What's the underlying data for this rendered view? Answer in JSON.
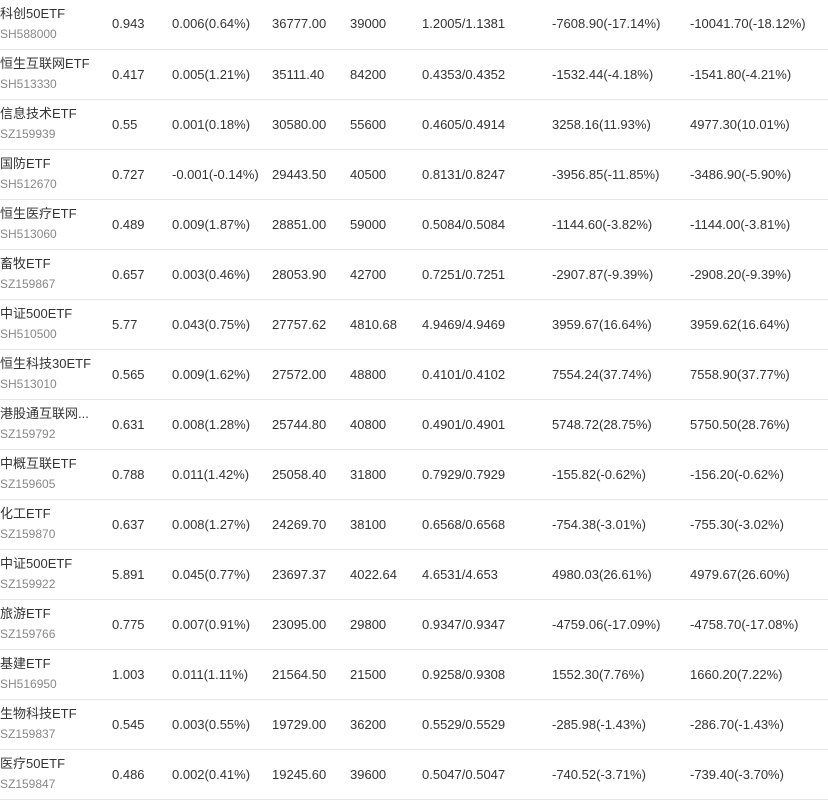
{
  "colors": {
    "up": "#e5302a",
    "down": "#2a9d3e",
    "text": "#333333",
    "code": "#888888",
    "divider": "#e5e5e5"
  },
  "rows": [
    {
      "name": "科创50ETF",
      "code": "SH588000",
      "price": "0.943",
      "change": "0.006(0.64%)",
      "change_dir": "up",
      "amount": "36777.00",
      "shares": "39000",
      "nav": "1.2005/1.1381",
      "profit1": "-7608.90(-17.14%)",
      "profit1_dir": "dn",
      "profit2": "-10041.70(-18.12%)",
      "profit2_dir": "dn"
    },
    {
      "name": "恒生互联网ETF",
      "code": "SH513330",
      "price": "0.417",
      "change": "0.005(1.21%)",
      "change_dir": "up",
      "amount": "35111.40",
      "shares": "84200",
      "nav": "0.4353/0.4352",
      "profit1": "-1532.44(-4.18%)",
      "profit1_dir": "dn",
      "profit2": "-1541.80(-4.21%)",
      "profit2_dir": "dn"
    },
    {
      "name": "信息技术ETF",
      "code": "SZ159939",
      "price": "0.55",
      "change": "0.001(0.18%)",
      "change_dir": "up",
      "amount": "30580.00",
      "shares": "55600",
      "nav": "0.4605/0.4914",
      "profit1": "3258.16(11.93%)",
      "profit1_dir": "up",
      "profit2": "4977.30(10.01%)",
      "profit2_dir": "up"
    },
    {
      "name": "国防ETF",
      "code": "SH512670",
      "price": "0.727",
      "change": "-0.001(-0.14%)",
      "change_dir": "dn",
      "amount": "29443.50",
      "shares": "40500",
      "nav": "0.8131/0.8247",
      "profit1": "-3956.85(-11.85%)",
      "profit1_dir": "dn",
      "profit2": "-3486.90(-5.90%)",
      "profit2_dir": "dn"
    },
    {
      "name": "恒生医疗ETF",
      "code": "SH513060",
      "price": "0.489",
      "change": "0.009(1.87%)",
      "change_dir": "up",
      "amount": "28851.00",
      "shares": "59000",
      "nav": "0.5084/0.5084",
      "profit1": "-1144.60(-3.82%)",
      "profit1_dir": "dn",
      "profit2": "-1144.00(-3.81%)",
      "profit2_dir": "dn"
    },
    {
      "name": "畜牧ETF",
      "code": "SZ159867",
      "price": "0.657",
      "change": "0.003(0.46%)",
      "change_dir": "up",
      "amount": "28053.90",
      "shares": "42700",
      "nav": "0.7251/0.7251",
      "profit1": "-2907.87(-9.39%)",
      "profit1_dir": "dn",
      "profit2": "-2908.20(-9.39%)",
      "profit2_dir": "dn"
    },
    {
      "name": "中证500ETF",
      "code": "SH510500",
      "price": "5.77",
      "change": "0.043(0.75%)",
      "change_dir": "up",
      "amount": "27757.62",
      "shares": "4810.68",
      "nav": "4.9469/4.9469",
      "profit1": "3959.67(16.64%)",
      "profit1_dir": "up",
      "profit2": "3959.62(16.64%)",
      "profit2_dir": "up"
    },
    {
      "name": "恒生科技30ETF",
      "code": "SH513010",
      "price": "0.565",
      "change": "0.009(1.62%)",
      "change_dir": "up",
      "amount": "27572.00",
      "shares": "48800",
      "nav": "0.4101/0.4102",
      "profit1": "7554.24(37.74%)",
      "profit1_dir": "up",
      "profit2": "7558.90(37.77%)",
      "profit2_dir": "up"
    },
    {
      "name": "港股通互联网...",
      "code": "SZ159792",
      "price": "0.631",
      "change": "0.008(1.28%)",
      "change_dir": "up",
      "amount": "25744.80",
      "shares": "40800",
      "nav": "0.4901/0.4901",
      "profit1": "5748.72(28.75%)",
      "profit1_dir": "up",
      "profit2": "5750.50(28.76%)",
      "profit2_dir": "up"
    },
    {
      "name": "中概互联ETF",
      "code": "SZ159605",
      "price": "0.788",
      "change": "0.011(1.42%)",
      "change_dir": "up",
      "amount": "25058.40",
      "shares": "31800",
      "nav": "0.7929/0.7929",
      "profit1": "-155.82(-0.62%)",
      "profit1_dir": "dn",
      "profit2": "-156.20(-0.62%)",
      "profit2_dir": "dn"
    },
    {
      "name": "化工ETF",
      "code": "SZ159870",
      "price": "0.637",
      "change": "0.008(1.27%)",
      "change_dir": "up",
      "amount": "24269.70",
      "shares": "38100",
      "nav": "0.6568/0.6568",
      "profit1": "-754.38(-3.01%)",
      "profit1_dir": "dn",
      "profit2": "-755.30(-3.02%)",
      "profit2_dir": "dn"
    },
    {
      "name": "中证500ETF",
      "code": "SZ159922",
      "price": "5.891",
      "change": "0.045(0.77%)",
      "change_dir": "up",
      "amount": "23697.37",
      "shares": "4022.64",
      "nav": "4.6531/4.653",
      "profit1": "4980.03(26.61%)",
      "profit1_dir": "up",
      "profit2": "4979.67(26.60%)",
      "profit2_dir": "up"
    },
    {
      "name": "旅游ETF",
      "code": "SZ159766",
      "price": "0.775",
      "change": "0.007(0.91%)",
      "change_dir": "up",
      "amount": "23095.00",
      "shares": "29800",
      "nav": "0.9347/0.9347",
      "profit1": "-4759.06(-17.09%)",
      "profit1_dir": "dn",
      "profit2": "-4758.70(-17.08%)",
      "profit2_dir": "dn"
    },
    {
      "name": "基建ETF",
      "code": "SH516950",
      "price": "1.003",
      "change": "0.011(1.11%)",
      "change_dir": "up",
      "amount": "21564.50",
      "shares": "21500",
      "nav": "0.9258/0.9308",
      "profit1": "1552.30(7.76%)",
      "profit1_dir": "up",
      "profit2": "1660.20(7.22%)",
      "profit2_dir": "up"
    },
    {
      "name": "生物科技ETF",
      "code": "SZ159837",
      "price": "0.545",
      "change": "0.003(0.55%)",
      "change_dir": "up",
      "amount": "19729.00",
      "shares": "36200",
      "nav": "0.5529/0.5529",
      "profit1": "-285.98(-1.43%)",
      "profit1_dir": "dn",
      "profit2": "-286.70(-1.43%)",
      "profit2_dir": "dn"
    },
    {
      "name": "医疗50ETF",
      "code": "SZ159847",
      "price": "0.486",
      "change": "0.002(0.41%)",
      "change_dir": "up",
      "amount": "19245.60",
      "shares": "39600",
      "nav": "0.5047/0.5047",
      "profit1": "-740.52(-3.71%)",
      "profit1_dir": "dn",
      "profit2": "-739.40(-3.70%)",
      "profit2_dir": "dn"
    }
  ]
}
